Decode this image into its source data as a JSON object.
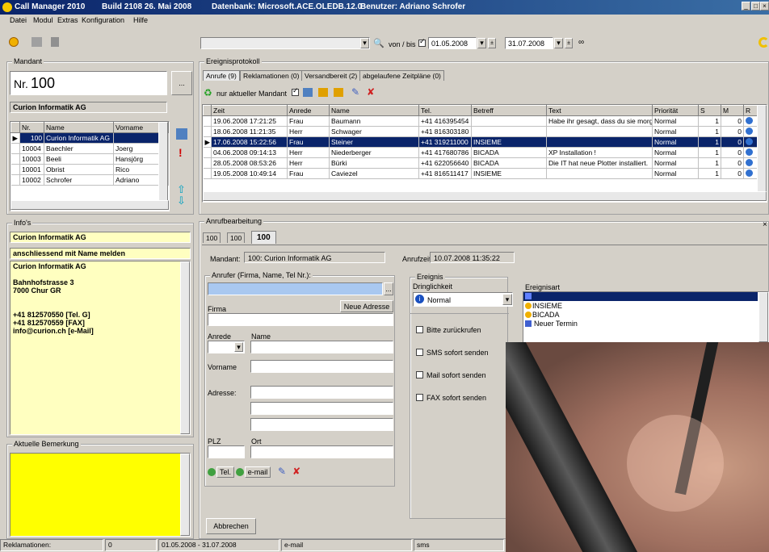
{
  "titlebar": {
    "app": "Call Manager 2010",
    "build": "Build 2108 26. Mai 2008",
    "db": "Datenbank: Microsoft.ACE.OLEDB.12.0",
    "user": "Benutzer: Adriano Schrofer",
    "color": "#0a246a"
  },
  "menu": [
    "Datei",
    "Modul",
    "Extras",
    "Konfiguration",
    "Hilfe"
  ],
  "toolbar": {
    "range_label": "von / bis",
    "date_from": "01.05.2008",
    "date_to": "31.07.2008"
  },
  "mandant": {
    "group": "Mandant",
    "nr_label": "Nr.",
    "nr_value": "100",
    "name": "Curion Informatik AG",
    "columns": [
      "Nr.",
      "Name",
      "Vorname"
    ],
    "rows": [
      {
        "nr": "100",
        "name": "Curion Informatik AG",
        "vorname": ""
      },
      {
        "nr": "10004",
        "name": "Baechler",
        "vorname": "Joerg"
      },
      {
        "nr": "10003",
        "name": "Beeli",
        "vorname": "Hansjörg"
      },
      {
        "nr": "10001",
        "name": "Obrist",
        "vorname": "Rico"
      },
      {
        "nr": "10002",
        "name": "Schrofer",
        "vorname": "Adriano"
      }
    ]
  },
  "infos": {
    "group": "Info's",
    "line1": "Curion Informatik AG",
    "line2": "anschliessend mit Name melden",
    "text": [
      "Curion Informatik AG",
      "",
      "Bahnhofstrasse 3",
      "7000 Chur GR",
      "",
      "",
      "+41 812570550 [Tel. G]",
      "+41 812570559 [FAX]",
      "info@curion.ch [e-Mail]"
    ]
  },
  "bemerkung": {
    "group": "Aktuelle Bemerkung"
  },
  "protokoll": {
    "group": "Ereignisprotokoll",
    "tabs": [
      "Anrufe (9)",
      "Reklamationen (0)",
      "Versandbereit (2)",
      "abgelaufene Zeitpläne (0)"
    ],
    "filter_label": "nur aktueller Mandant",
    "columns": [
      "Zeit",
      "Anrede",
      "Name",
      "Tel.",
      "Betreff",
      "Text",
      "Priorität",
      "S",
      "M",
      "R"
    ],
    "rows": [
      {
        "zeit": "19.06.2008 17:21:25",
        "anrede": "Frau",
        "name": "Baumann",
        "tel": "+41 416395454",
        "betreff": "",
        "text": "Habe ihr gesagt, dass du sie morg",
        "prio": "Normal",
        "s": "1",
        "m": "0"
      },
      {
        "zeit": "18.06.2008 11:21:35",
        "anrede": "Herr",
        "name": "Schwager",
        "tel": "+41 816303180",
        "betreff": "",
        "text": "",
        "prio": "Normal",
        "s": "1",
        "m": "0"
      },
      {
        "zeit": "17.06.2008 15:22:56",
        "anrede": "Frau",
        "name": "Steiner",
        "tel": "+41 319211000",
        "betreff": "INSIEME",
        "text": "",
        "prio": "Normal",
        "s": "1",
        "m": "0"
      },
      {
        "zeit": "04.06.2008 09:14:13",
        "anrede": "Herr",
        "name": "Niederberger",
        "tel": "+41 417680786",
        "betreff": "BICADA",
        "text": "XP Installation !",
        "prio": "Normal",
        "s": "1",
        "m": "0"
      },
      {
        "zeit": "28.05.2008 08:53:26",
        "anrede": "Herr",
        "name": "Bürki",
        "tel": "+41 622056640",
        "betreff": "BICADA",
        "text": "Die IT hat neue Plotter installiert.",
        "prio": "Normal",
        "s": "1",
        "m": "0"
      },
      {
        "zeit": "19.05.2008 10:49:14",
        "anrede": "Frau",
        "name": "Caviezel",
        "tel": "+41 816511417",
        "betreff": "INSIEME",
        "text": "",
        "prio": "Normal",
        "s": "1",
        "m": "0"
      }
    ]
  },
  "bearbeitung": {
    "group": "Anrufbearbeitung",
    "tabs": [
      "100",
      "100",
      "100"
    ],
    "mandant_label": "Mandant:",
    "mandant_value": "100:  Curion Informatik AG",
    "anrufzeit_label": "Anrufzeit:",
    "anrufzeit_value": "10.07.2008 11:35:22",
    "anrufer_group": "Anrufer (Firma, Name, Tel Nr.):",
    "firma_label": "Firma",
    "neue_adresse": "Neue Adresse",
    "anrede_label": "Anrede",
    "name_label": "Name",
    "vorname_label": "Vorname",
    "adresse_label": "Adresse:",
    "plz_label": "PLZ",
    "ort_label": "Ort",
    "tel_button": "Tel.",
    "email_button": "e-mail",
    "abbrechen": "Abbrechen"
  },
  "ereignis": {
    "group": "Ereignis",
    "dringlichkeit_label": "Dringlichkeit",
    "dringlichkeit_value": "Normal",
    "checks": [
      "Bitte zurückrufen",
      "SMS sofort senden",
      "Mail sofort senden",
      "FAX sofort senden"
    ],
    "art_label": "Ereignisart",
    "art_items": [
      "INSIEME",
      "BICADA",
      "Neuer Termin"
    ]
  },
  "statusbar": {
    "reklamationen": "Reklamationen:",
    "count": "0",
    "range": "01.05.2008 - 31.07.2008",
    "email": "e-mail",
    "sms": "sms"
  }
}
